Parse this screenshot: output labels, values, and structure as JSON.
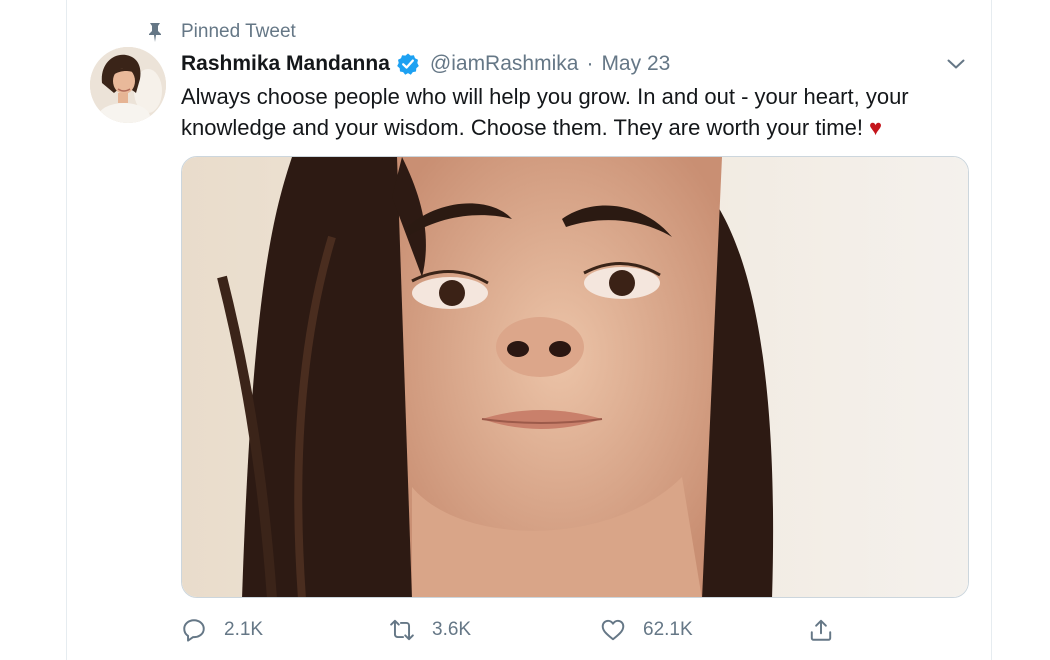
{
  "pinned": {
    "label": "Pinned Tweet",
    "icon": "pin-icon"
  },
  "tweet": {
    "author": {
      "name": "Rashmika Mandanna",
      "handle": "@iamRashmika",
      "verified": true,
      "avatar": "avatar-photo"
    },
    "separator": "·",
    "date": "May 23",
    "text": "Always choose people who will help you grow. In and out - your heart, your knowledge and your wisdom. Choose them. They are worth your time! ",
    "emoji": "♥",
    "media": {
      "type": "photo"
    },
    "actions": {
      "reply": {
        "icon": "reply-icon",
        "count": "2.1K"
      },
      "retweet": {
        "icon": "retweet-icon",
        "count": "3.6K"
      },
      "like": {
        "icon": "heart-icon",
        "count": "62.1K"
      },
      "share": {
        "icon": "share-icon"
      }
    }
  },
  "colors": {
    "secondary_text": "#657786",
    "primary_text": "#14171a",
    "verified_blue": "#1da1f2",
    "heart_red": "#c4151c",
    "border": "#e6ecf0"
  }
}
